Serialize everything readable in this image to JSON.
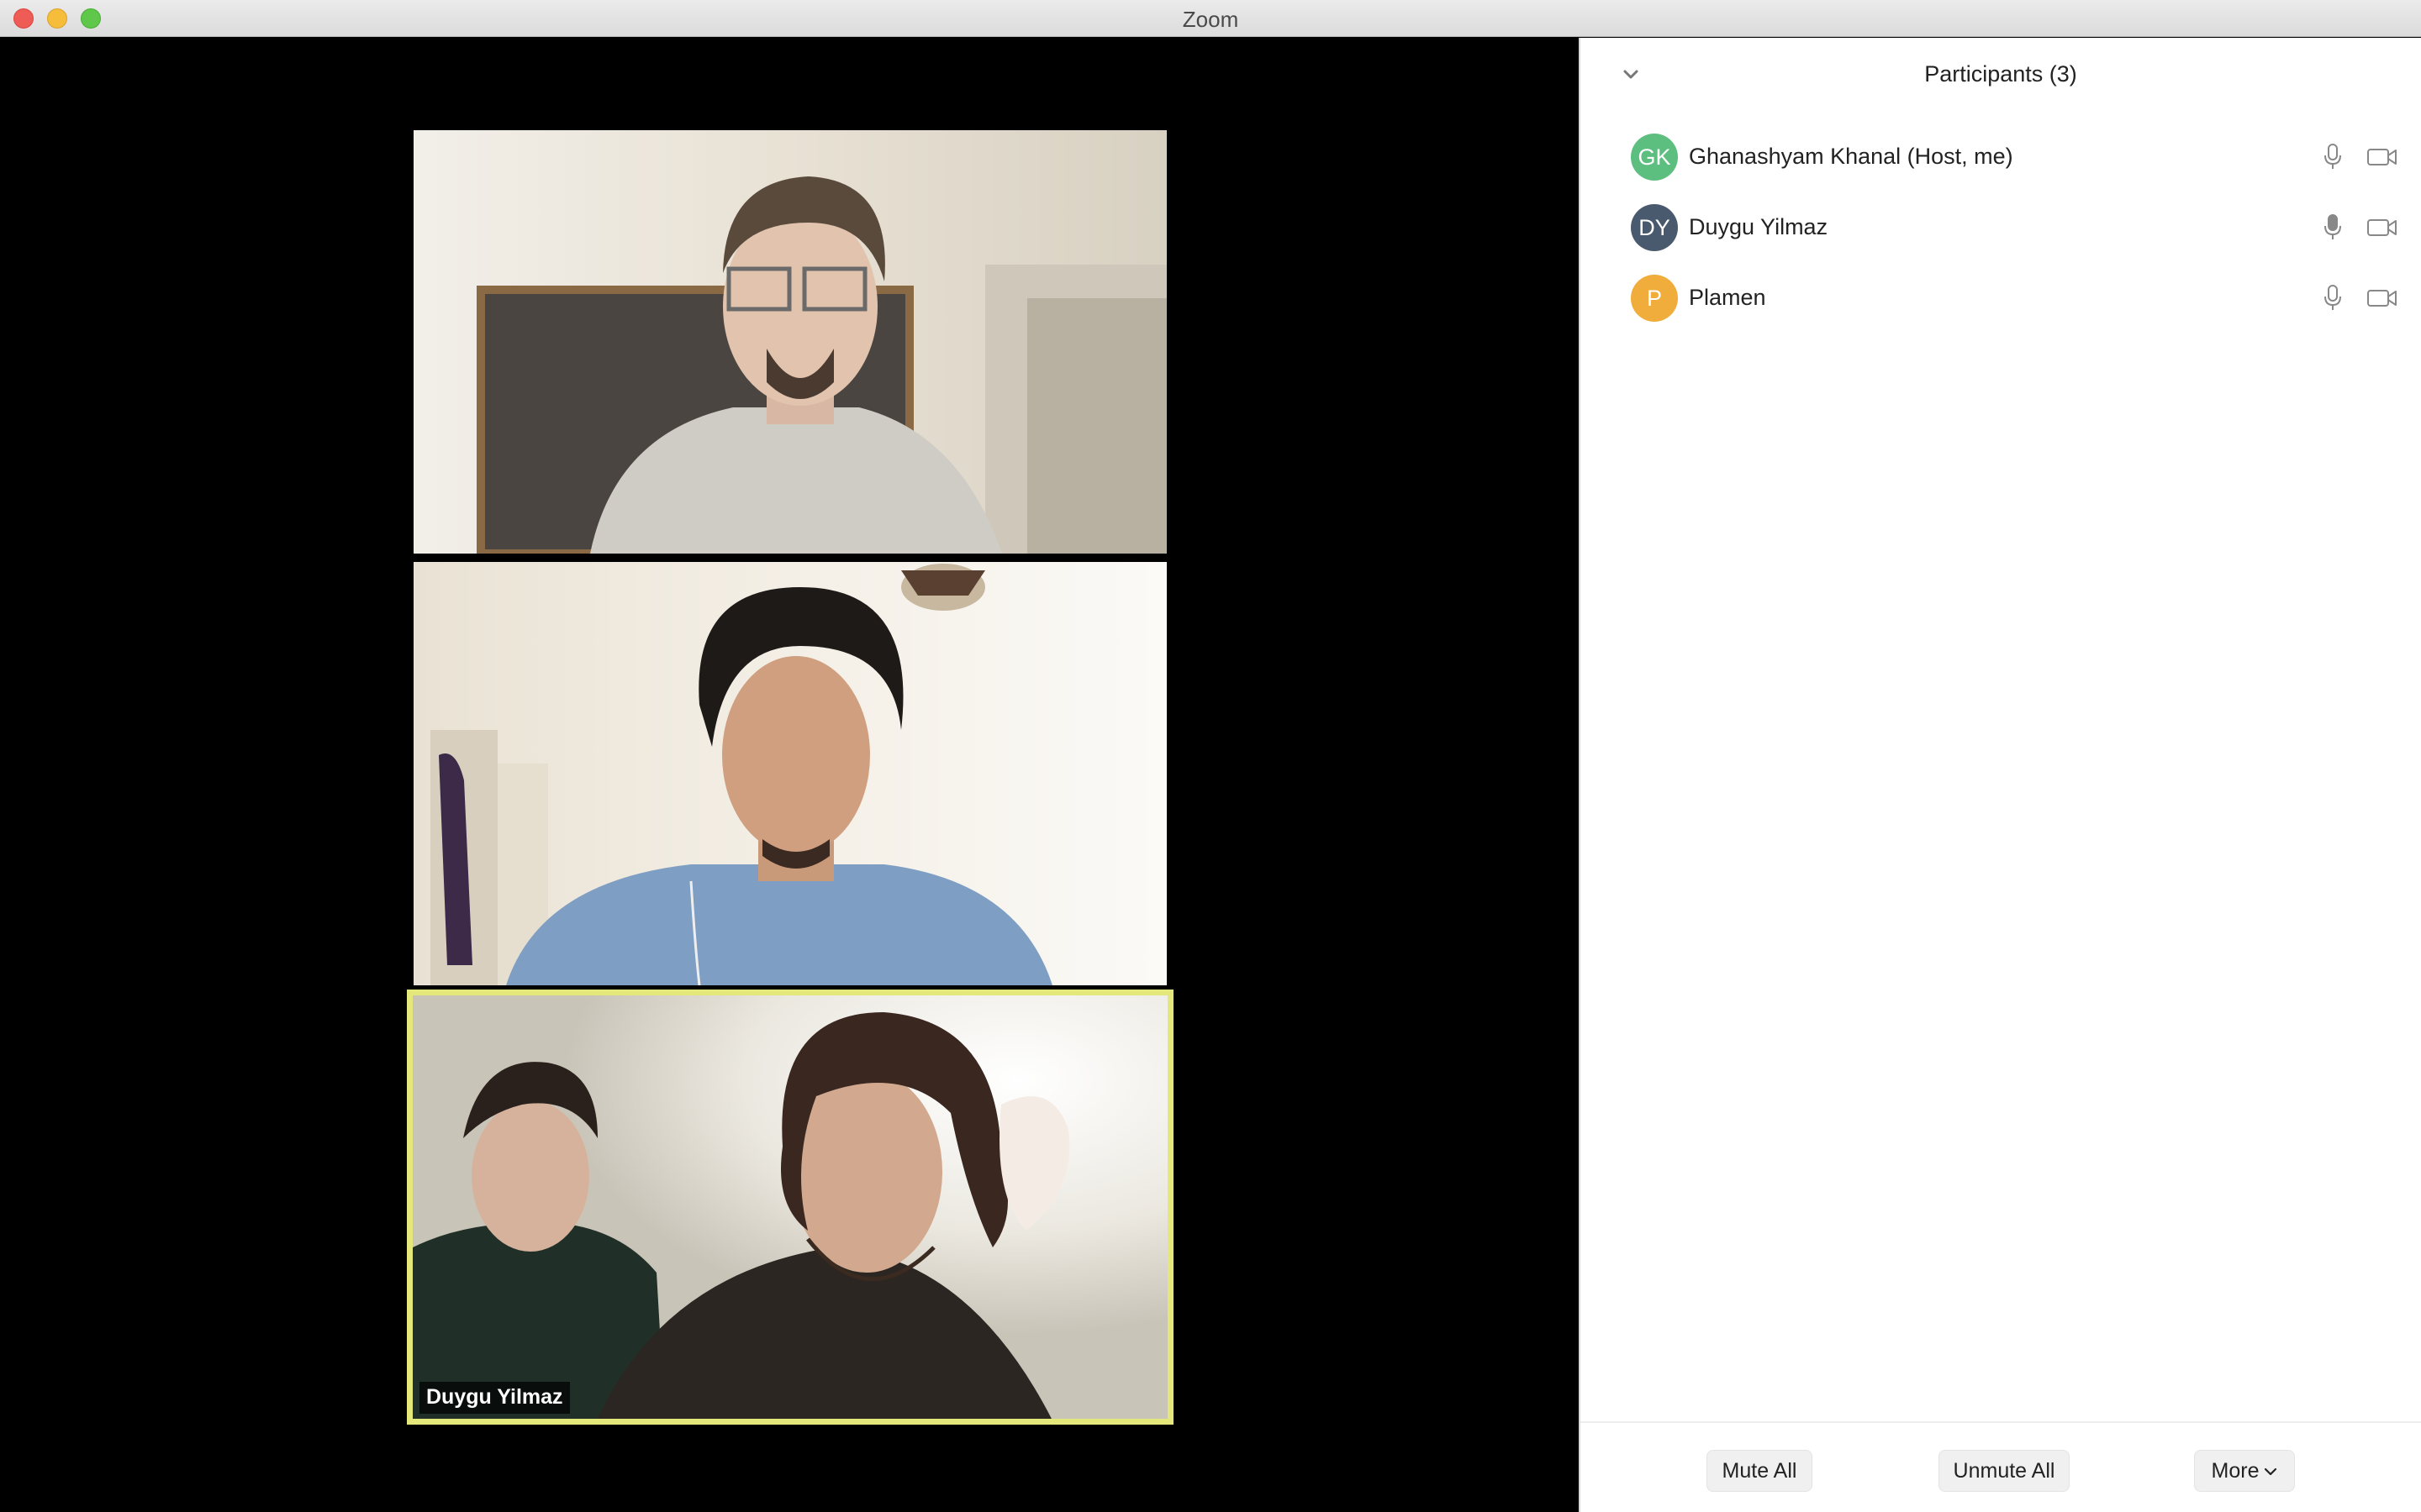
{
  "window": {
    "title": "Zoom"
  },
  "video": {
    "tiles": [
      {
        "name_label": ""
      },
      {
        "name_label": ""
      },
      {
        "name_label": "Duygu Yilmaz",
        "active_speaker": true
      }
    ],
    "active_speaker_border_color": "#e4e77a"
  },
  "panel": {
    "title": "Participants (3)",
    "participants": [
      {
        "initials": "GK",
        "name": "Ghanashyam Khanal (Host, me)",
        "avatar_color": "#5cbf80",
        "mic_icon": "mic-icon",
        "video_icon": "video-camera-icon"
      },
      {
        "initials": "DY",
        "name": "Duygu Yilmaz",
        "avatar_color": "#4a5a6e",
        "mic_icon": "mic-active-icon",
        "video_icon": "video-camera-icon"
      },
      {
        "initials": "P",
        "name": "Plamen",
        "avatar_color": "#f0ad3b",
        "mic_icon": "mic-icon",
        "video_icon": "video-camera-icon"
      }
    ],
    "footer": {
      "mute_all": "Mute All",
      "unmute_all": "Unmute All",
      "more": "More"
    }
  }
}
